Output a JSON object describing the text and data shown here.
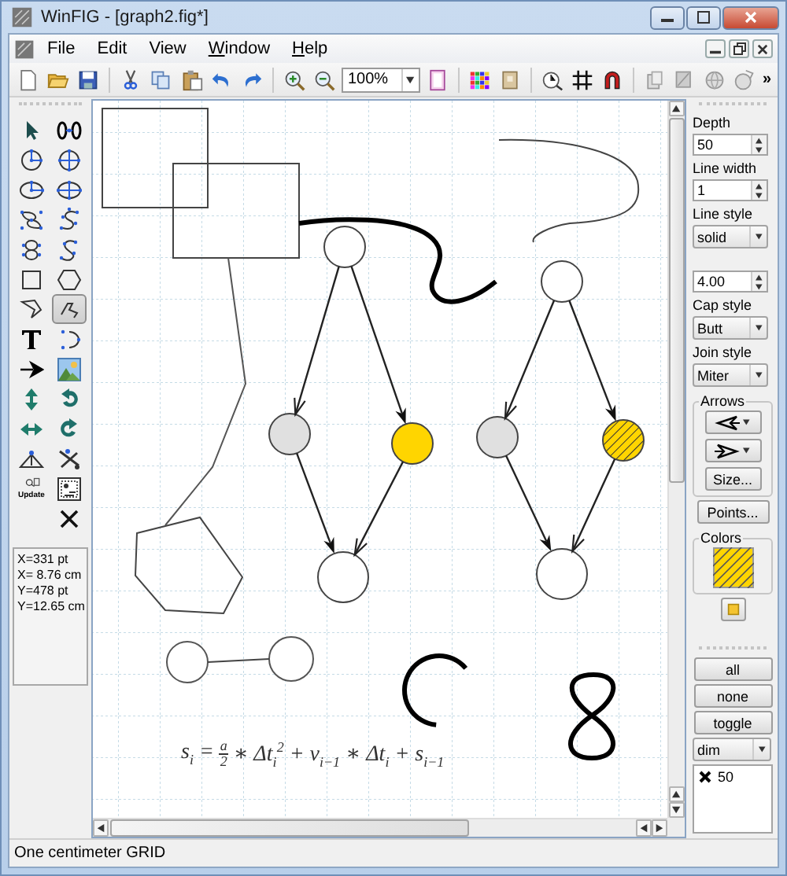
{
  "window": {
    "title": "WinFIG - [graph2.fig*]"
  },
  "menu": [
    {
      "label": "File",
      "mnemonic_shown": false
    },
    {
      "label": "Edit",
      "mnemonic_shown": false
    },
    {
      "label": "View",
      "mnemonic_shown": false
    },
    {
      "label": "Window",
      "mnemonic_shown": true
    },
    {
      "label": "Help",
      "mnemonic_shown": true
    }
  ],
  "toolbar": {
    "zoom": "100%",
    "overflow": "»"
  },
  "tools": [
    {
      "selected": false
    },
    {
      "selected": false
    },
    {
      "selected": false
    },
    {
      "selected": false
    },
    {
      "selected": false
    },
    {
      "selected": false
    },
    {
      "selected": false
    },
    {
      "selected": false
    },
    {
      "selected": false
    },
    {
      "selected": false
    },
    {
      "selected": false
    },
    {
      "selected": false
    },
    {
      "selected": false
    },
    {
      "selected": true
    },
    {
      "selected": false
    },
    {
      "selected": false
    },
    {
      "selected": false
    },
    {
      "selected": false
    },
    {
      "selected": false
    },
    {
      "selected": false
    },
    {
      "selected": false
    },
    {
      "selected": false
    },
    {
      "selected": false
    },
    {
      "selected": false
    },
    {
      "selected": false,
      "label": "Update"
    },
    {
      "selected": false
    },
    {
      "selected": false
    }
  ],
  "coordinates": [
    "X=331 pt",
    "X= 8.76 cm",
    "Y=478 pt",
    "Y=12.65 cm"
  ],
  "canvas": {
    "formula": {
      "lhs": "s$_{i}$ =",
      "numerator": "a",
      "denominator": "2",
      "rhs": "∗ Δt$_{i}$$^{2}$ + v$_{i−1}$ ∗ Δt$_{i}$ + s$_{i−1}$"
    }
  },
  "properties": [
    {
      "kind": "spinner",
      "label": "Depth",
      "value": "50"
    },
    {
      "kind": "spinner",
      "label": "Line width",
      "value": "1"
    },
    {
      "kind": "dropdown",
      "label": "Line style",
      "value": "solid"
    },
    {
      "kind": "spinner",
      "value": "4.00"
    },
    {
      "kind": "dropdown",
      "label": "Cap style",
      "value": "Butt"
    },
    {
      "kind": "dropdown",
      "label": "Join style",
      "value": "Miter"
    }
  ],
  "arrows": {
    "label": "Arrows",
    "size_button": "Size..."
  },
  "points_button": "Points...",
  "colors": {
    "label": "Colors"
  },
  "depths": {
    "buttons": [
      "all",
      "none",
      "toggle"
    ],
    "mode": "dim",
    "items": [
      {
        "label": "50",
        "checked": true
      }
    ]
  },
  "status_bar": "One centimeter GRID"
}
